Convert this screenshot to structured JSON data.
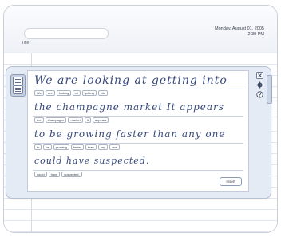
{
  "header": {
    "title_label": "Title",
    "date": "Monday, August 01, 2005",
    "time": "2:39 PM"
  },
  "input_panel": {
    "lines": [
      {
        "handwriting": "We are looking at getting into",
        "recognized_words": [
          "We",
          "are",
          "looking",
          "at",
          "getting",
          "into"
        ]
      },
      {
        "handwriting": "the champagne market It appears",
        "recognized_words": [
          "the",
          "champagne",
          "market",
          "It",
          "appears"
        ]
      },
      {
        "handwriting": "to be growing faster than any one",
        "recognized_words": [
          "to",
          "be",
          "growing",
          "faster",
          "than",
          "any",
          "one"
        ]
      },
      {
        "handwriting": "could have suspected.",
        "recognized_words": [
          "could",
          "have",
          "suspected."
        ]
      }
    ],
    "insert_label": "Insert"
  },
  "icons": {
    "close": "close-icon",
    "options": "gear-icon",
    "help": "help-icon"
  },
  "colors": {
    "ink": "#36497a",
    "panel_bg": "#e5ebf5",
    "panel_border": "#b3bfd3"
  }
}
